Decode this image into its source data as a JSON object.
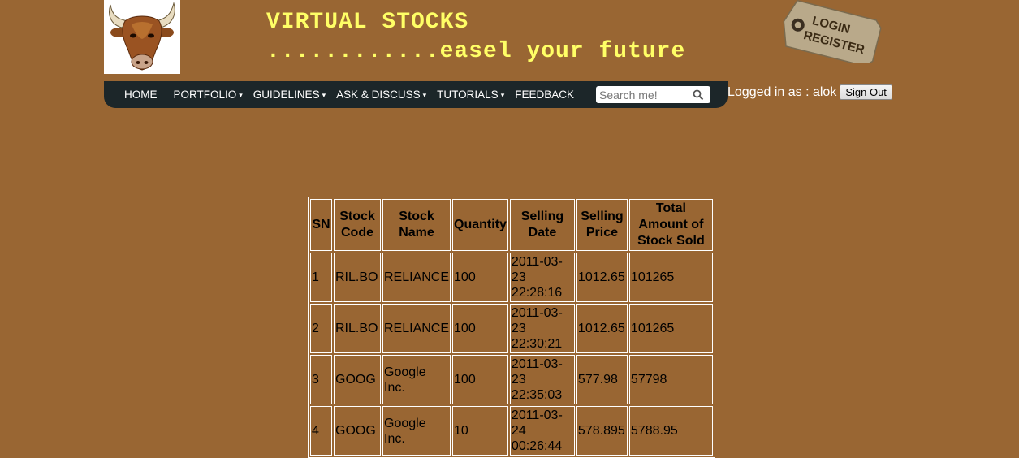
{
  "site": {
    "title": "VIRTUAL STOCKS",
    "tagline": "............easel your future"
  },
  "login_tag": {
    "line1": "LOGIN",
    "line2": "REGISTER"
  },
  "nav": {
    "items": [
      {
        "label": "HOME",
        "has_dropdown": false
      },
      {
        "label": "PORTFOLIO",
        "has_dropdown": true
      },
      {
        "label": "GUIDELINES",
        "has_dropdown": true
      },
      {
        "label": "ASK & DISCUSS",
        "has_dropdown": true
      },
      {
        "label": "TUTORIALS",
        "has_dropdown": true
      },
      {
        "label": "FEEDBACK",
        "has_dropdown": false
      }
    ],
    "search_placeholder": "Search me!"
  },
  "user": {
    "logged_in_text": "Logged in as : alok",
    "signout_label": "Sign Out"
  },
  "table": {
    "headers": [
      "SN",
      "Stock Code",
      "Stock Name",
      "Quantity",
      "Selling Date",
      "Selling Price",
      "Total Amount of Stock Sold"
    ],
    "rows": [
      {
        "sn": "1",
        "code": "RIL.BO",
        "name": "RELIANCE",
        "qty": "100",
        "date": "2011-03-23 22:28:16",
        "price": "1012.65",
        "total": "101265"
      },
      {
        "sn": "2",
        "code": "RIL.BO",
        "name": "RELIANCE",
        "qty": "100",
        "date": "2011-03-23 22:30:21",
        "price": "1012.65",
        "total": "101265"
      },
      {
        "sn": "3",
        "code": "GOOG",
        "name": "Google Inc.",
        "qty": "100",
        "date": "2011-03-23 22:35:03",
        "price": "577.98",
        "total": "57798"
      },
      {
        "sn": "4",
        "code": "GOOG",
        "name": "Google Inc.",
        "qty": "10",
        "date": "2011-03-24 00:26:44",
        "price": "578.895",
        "total": "5788.95"
      }
    ]
  },
  "colors": {
    "page_background": "#996633",
    "title_yellow": "#ffff66",
    "navbar": "#1c2629"
  }
}
